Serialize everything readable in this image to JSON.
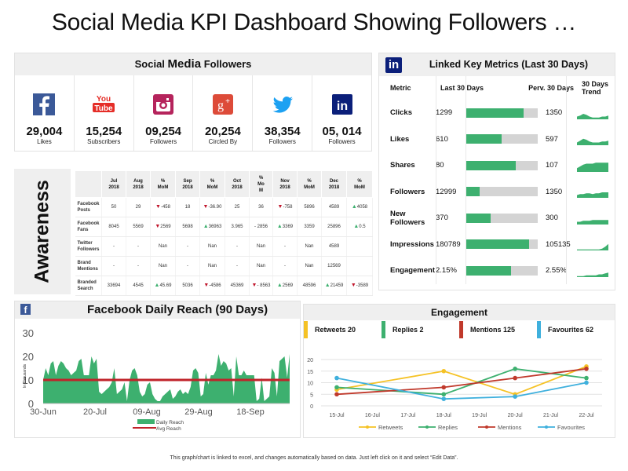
{
  "title": "Social Media KPI Dashboard Showing Followers …",
  "social_followers": {
    "title_prefix": "Social",
    "title_mid": "Media",
    "title_suffix": "Followers",
    "items": [
      {
        "platform": "Facebook",
        "icon": "facebook-icon",
        "value": "29,004",
        "label": "Likes",
        "color": "#3b5998"
      },
      {
        "platform": "YouTube",
        "icon": "youtube-icon",
        "value": "15,254",
        "label": "Subscribers",
        "color": "#e52d27"
      },
      {
        "platform": "Instagram",
        "icon": "instagram-icon",
        "value": "09,254",
        "label": "Followers",
        "color": "#b5245c"
      },
      {
        "platform": "Google Plus",
        "icon": "google-plus-icon",
        "value": "20,254",
        "label": "Circled By",
        "color": "#dd4b39"
      },
      {
        "platform": "Twitter",
        "icon": "twitter-icon",
        "value": "38,354",
        "label": "Followers",
        "color": "#1da1f2"
      },
      {
        "platform": "LinkedIn",
        "icon": "linkedin-icon",
        "value": "05, 014",
        "label": "Followers",
        "color": "#0b1f7a"
      }
    ]
  },
  "linkedin_metrics": {
    "badge": "in",
    "title": "Linked Key Metrics (Last 30 Days)",
    "headers": {
      "metric": "Metric",
      "last": "Last 30 Days",
      "prev": "Perv. 30 Days",
      "trend": "30 Days Trend"
    },
    "rows": [
      {
        "metric": "Clicks",
        "last": "1299",
        "prev": "1350",
        "bar_fraction": 0.8,
        "trend": [
          3,
          4,
          6,
          5,
          3,
          2,
          2,
          2,
          3,
          3,
          4
        ]
      },
      {
        "metric": "Likes",
        "last": "610",
        "prev": "597",
        "bar_fraction": 0.5,
        "trend": [
          3,
          5,
          7,
          6,
          4,
          3,
          3,
          3,
          4,
          4,
          5
        ]
      },
      {
        "metric": "Shares",
        "last": "80",
        "prev": "107",
        "bar_fraction": 0.7,
        "trend": [
          4,
          6,
          8,
          9,
          9,
          9,
          10,
          10,
          10,
          10,
          10
        ]
      },
      {
        "metric": "Followers",
        "last": "12999",
        "prev": "1350",
        "bar_fraction": 0.2,
        "trend": [
          3,
          4,
          4,
          5,
          5,
          4,
          5,
          5,
          6,
          6,
          6
        ]
      },
      {
        "metric": "New Followers",
        "last": "370",
        "prev": "300",
        "bar_fraction": 0.35,
        "trend": [
          3,
          3,
          4,
          4,
          4,
          5,
          5,
          5,
          5,
          5,
          5
        ]
      },
      {
        "metric": "Impressions",
        "last": "180789",
        "prev": "105135",
        "bar_fraction": 0.88,
        "trend": [
          1,
          1,
          1,
          1,
          1,
          1,
          1,
          1,
          2,
          4,
          7
        ]
      },
      {
        "metric": "Engagement",
        "last": "2.15%",
        "prev": "2.55%",
        "bar_fraction": 0.63,
        "trend": [
          1,
          1,
          1,
          2,
          2,
          2,
          2,
          3,
          3,
          4,
          5
        ]
      }
    ],
    "bar_color": "#3db06f",
    "bar_bg": "#d4d4d4"
  },
  "awareness": {
    "label": "Awareness",
    "columns": [
      "",
      "Jul 2018",
      "Aug 2018",
      "% MoM",
      "Sep 2018",
      "% MoM",
      "Oct 2018",
      "% Mo M",
      "Nov 2018",
      "% MoM",
      "Dec 2018",
      "% MoM"
    ],
    "rows": [
      {
        "label": "Facebook Posts",
        "cells": [
          {
            "v": "50"
          },
          {
            "v": "29"
          },
          {
            "v": "-458",
            "t": "down"
          },
          {
            "v": "18"
          },
          {
            "v": "-36.90",
            "t": "down"
          },
          {
            "v": "25"
          },
          {
            "v": "36"
          },
          {
            "v": "-758",
            "t": "down"
          },
          {
            "v": "5896"
          },
          {
            "v": "4589"
          },
          {
            "v": "4058",
            "t": "up"
          }
        ]
      },
      {
        "label": "Facebook Fans",
        "cells": [
          {
            "v": "8045"
          },
          {
            "v": "5569"
          },
          {
            "v": "2569",
            "t": "down"
          },
          {
            "v": "5698"
          },
          {
            "v": "36963",
            "t": "up"
          },
          {
            "v": "3.965"
          },
          {
            "v": "- 2856"
          },
          {
            "v": "3369",
            "t": "up"
          },
          {
            "v": "3359"
          },
          {
            "v": "25896"
          },
          {
            "v": "0.5",
            "t": "up"
          }
        ]
      },
      {
        "label": "Twitter Followers",
        "cells": [
          {
            "v": "-"
          },
          {
            "v": "-"
          },
          {
            "v": "Nan"
          },
          {
            "v": "-"
          },
          {
            "v": "Nan"
          },
          {
            "v": "-"
          },
          {
            "v": "Nan"
          },
          {
            "v": "-"
          },
          {
            "v": "Nan"
          },
          {
            "v": "4589"
          },
          {
            "v": ""
          }
        ]
      },
      {
        "label": "Brand Mentions",
        "cells": [
          {
            "v": "-"
          },
          {
            "v": "-"
          },
          {
            "v": "Nan"
          },
          {
            "v": "-"
          },
          {
            "v": "Nan"
          },
          {
            "v": "-"
          },
          {
            "v": "Nan"
          },
          {
            "v": "-"
          },
          {
            "v": "Nan"
          },
          {
            "v": "12569"
          },
          {
            "v": ""
          }
        ]
      },
      {
        "label": "Branded Search",
        "cells": [
          {
            "v": "33694"
          },
          {
            "v": "4545"
          },
          {
            "v": "45.69",
            "t": "up"
          },
          {
            "v": "5036"
          },
          {
            "v": "-4586",
            "t": "down"
          },
          {
            "v": "45369"
          },
          {
            "v": "- 8563",
            "t": "down"
          },
          {
            "v": "2569",
            "t": "up"
          },
          {
            "v": "48596"
          },
          {
            "v": "21459",
            "t": "up"
          },
          {
            "v": "-3589",
            "t": "down"
          }
        ]
      }
    ]
  },
  "facebook_reach": {
    "icon": "f",
    "title": "Facebook Daily Reach (90 Days)",
    "chart_data": {
      "type": "area",
      "title": "Facebook Daily Reach (90 Days)",
      "ylabel": "In Thousands",
      "xlabel": "",
      "ylim": [
        0,
        30
      ],
      "yticks": [
        "0",
        "10",
        "20",
        "30"
      ],
      "xticks": [
        "30-Jun",
        "20-Jul",
        "09-Aug",
        "29-Aug",
        "18-Sep"
      ],
      "series": [
        {
          "name": "Daily Reach",
          "color": "#3db06f",
          "values": [
            10,
            15,
            12,
            17,
            18,
            12,
            16,
            18,
            17,
            15,
            14,
            12,
            13,
            14,
            18,
            19,
            12,
            12,
            12,
            20,
            17,
            19,
            5,
            4,
            5,
            6,
            7,
            9,
            15,
            4,
            5,
            6,
            9,
            1,
            10,
            14,
            15,
            12,
            5,
            3,
            4,
            8,
            9,
            4,
            2,
            1,
            1,
            3,
            4,
            5,
            6,
            2,
            3,
            5,
            6,
            4,
            5,
            4,
            7,
            14,
            15,
            13,
            3,
            4,
            13,
            8,
            12,
            12,
            14,
            21,
            16,
            18,
            17,
            14,
            15,
            3,
            20,
            12,
            12,
            14,
            12,
            12,
            12,
            12,
            1,
            2,
            11,
            1,
            2,
            3,
            15,
            13,
            3,
            18,
            19,
            20,
            11,
            21
          ]
        },
        {
          "name": "Avg Reach",
          "color": "#c0232a",
          "values": [
            10
          ]
        }
      ],
      "legend": [
        "Daily Reach",
        "Avg Reach"
      ],
      "legend_position": "bottom"
    }
  },
  "engagement": {
    "title": "Engagement",
    "legend_cards": [
      {
        "label": "Retweets 20",
        "color": "#f5c225"
      },
      {
        "label": "Replies 2",
        "color": "#3db06f"
      },
      {
        "label": "Mentions 125",
        "color": "#c0392b"
      },
      {
        "label": "Favourites 62",
        "color": "#3fb0dd"
      }
    ],
    "chart_data": {
      "type": "line",
      "title": "",
      "xlabel": "",
      "ylabel": "",
      "ylim": [
        0,
        20
      ],
      "yticks": [
        "0",
        "5",
        "10",
        "15",
        "20"
      ],
      "x": [
        "15-Jul",
        "16-Jul",
        "17-Jul",
        "18-Jul",
        "19-Jul",
        "20-Jul",
        "21-Jul",
        "22-Jul"
      ],
      "series": [
        {
          "name": "Retweets",
          "color": "#f5c225",
          "points": [
            [
              0,
              7
            ],
            [
              3,
              15
            ],
            [
              5,
              5
            ],
            [
              7,
              17
            ]
          ]
        },
        {
          "name": "Replies",
          "color": "#3db06f",
          "points": [
            [
              0,
              8
            ],
            [
              3,
              5
            ],
            [
              5,
              16
            ],
            [
              7,
              12
            ]
          ]
        },
        {
          "name": "Mentions",
          "color": "#c0392b",
          "points": [
            [
              0,
              5
            ],
            [
              3,
              8
            ],
            [
              5,
              12
            ],
            [
              7,
              16
            ]
          ]
        },
        {
          "name": "Favourites",
          "color": "#3fb0dd",
          "points": [
            [
              0,
              12
            ],
            [
              3,
              3
            ],
            [
              5,
              4
            ],
            [
              7,
              10
            ]
          ]
        }
      ],
      "legend_position": "bottom",
      "grid": true
    }
  },
  "footer": "This graph/chart is linked to excel, and changes automatically based on data. Just left click on it and select “Edit Data”."
}
